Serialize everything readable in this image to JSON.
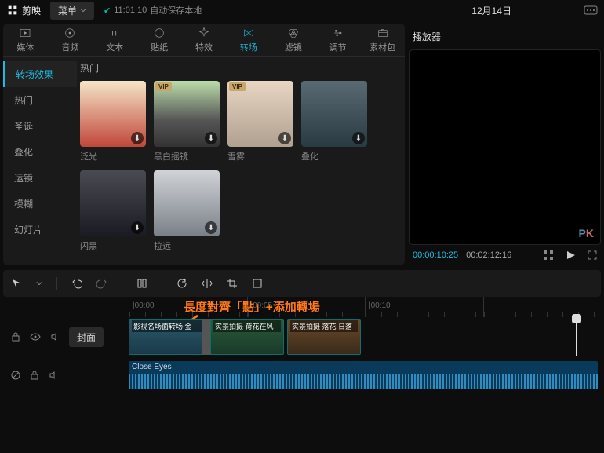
{
  "app": {
    "name": "剪映",
    "menu_label": "菜单"
  },
  "status": {
    "time": "11:01:10",
    "text": "自动保存本地"
  },
  "header": {
    "date": "12月14日"
  },
  "tabs": [
    {
      "id": "media",
      "label": "媒体"
    },
    {
      "id": "audio",
      "label": "音频"
    },
    {
      "id": "text",
      "label": "文本"
    },
    {
      "id": "sticker",
      "label": "贴纸"
    },
    {
      "id": "effect",
      "label": "特效"
    },
    {
      "id": "transition",
      "label": "转场",
      "active": true
    },
    {
      "id": "filter",
      "label": "滤镜"
    },
    {
      "id": "adjust",
      "label": "调节"
    },
    {
      "id": "pack",
      "label": "素材包"
    }
  ],
  "sidebar": {
    "items": [
      {
        "label": "转场效果",
        "active": true
      },
      {
        "label": "热门"
      },
      {
        "label": "圣诞"
      },
      {
        "label": "叠化"
      },
      {
        "label": "运镜"
      },
      {
        "label": "模糊"
      },
      {
        "label": "幻灯片"
      }
    ]
  },
  "main": {
    "section_title": "热门",
    "items": [
      {
        "label": "泛光",
        "vip": false,
        "bg": "linear-gradient(#f5e6c8,#c0463a)"
      },
      {
        "label": "黑白摇镜",
        "vip": true,
        "bg": "linear-gradient(#bda,#555 60%,#333)"
      },
      {
        "label": "雪雾",
        "vip": true,
        "bg": "linear-gradient(#e8d6c2,#b0a090)"
      },
      {
        "label": "叠化",
        "vip": false,
        "bg": "linear-gradient(#5a6a72,#2a3a42)"
      },
      {
        "label": "闪黑",
        "vip": false,
        "bg": "linear-gradient(#4a4a52,#1a1a22)"
      },
      {
        "label": "拉远",
        "vip": false,
        "bg": "linear-gradient(#d0d4d8,#7a8088)"
      }
    ]
  },
  "player": {
    "title": "播放器",
    "current": "00:00:10:25",
    "duration": "00:02:12:16",
    "watermark_p": "P",
    "watermark_k": "K"
  },
  "ruler": {
    "marks": [
      "|00:00",
      "|00:05",
      "|00:10"
    ]
  },
  "annotation": {
    "text": "長度對齊「點」+添加轉場"
  },
  "tracks": {
    "video": {
      "cover_label": "封面",
      "clips": [
        {
          "label": "影视名场面转场  金"
        },
        {
          "label": "实景拍摄 荷花在风"
        },
        {
          "label": "实景拍摄 落花 日落"
        }
      ]
    },
    "audio": {
      "clip_label": "Close Eyes"
    }
  },
  "vip_label": "VIP"
}
